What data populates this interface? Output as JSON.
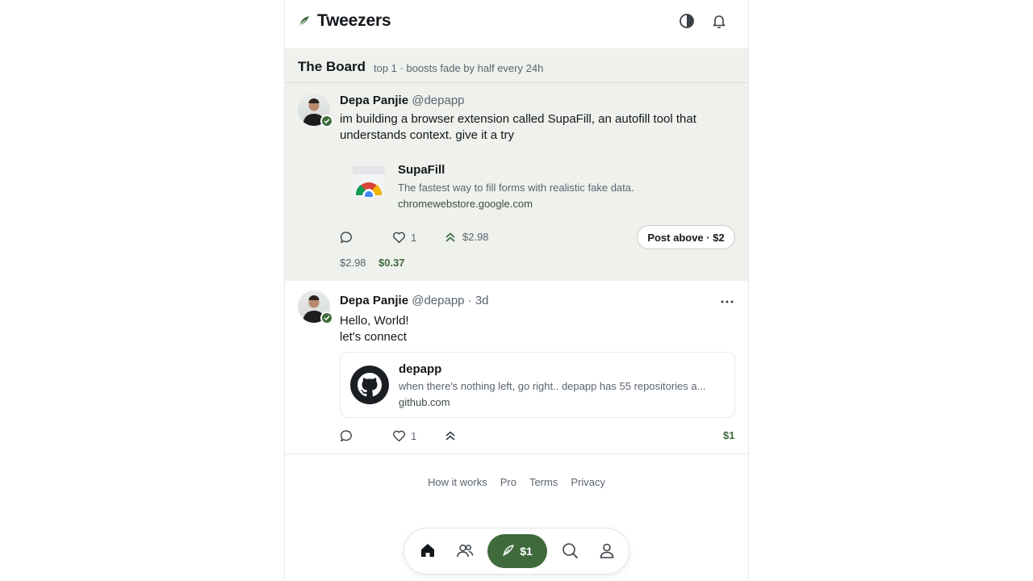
{
  "app": {
    "title": "Tweezers"
  },
  "header": {
    "theme_icon": "contrast-icon",
    "notifications_icon": "bell-icon"
  },
  "board": {
    "title": "The Board",
    "subtitle": "top 1 · boosts fade by half every 24h",
    "post": {
      "author_name": "Depa Panjie",
      "handle": "@depapp",
      "text": "im building a browser extension called SupaFill, an autofill tool that understands context. give it a try",
      "card": {
        "title": "SupaFill",
        "description": "The fastest way to fill forms with realistic fake data.",
        "url": "chromewebstore.google.com",
        "icon": "chrome-icon"
      },
      "likes": "1",
      "boost_amount": "$2.98",
      "post_above_label": "Post above · $2",
      "price_paid": "$2.98",
      "price_current": "$0.37"
    }
  },
  "feed": {
    "post": {
      "author_name": "Depa Panjie",
      "handle": "@depapp",
      "time": "· 3d",
      "text_line1": "Hello, World!",
      "text_line2": "let's connect",
      "card": {
        "title": "depapp",
        "description": "when there's nothing left, go right.. depapp has 55 repositories a...",
        "url": "github.com",
        "icon": "github-icon"
      },
      "likes": "1",
      "price": "$1"
    }
  },
  "footer": {
    "links": [
      "How it works",
      "Pro",
      "Terms",
      "Privacy"
    ]
  },
  "nav": {
    "compose_label": "$1",
    "accent": "#3f6a3c"
  },
  "colors": {
    "board_bg": "#eef1ec",
    "accent": "#3f6a3c"
  }
}
